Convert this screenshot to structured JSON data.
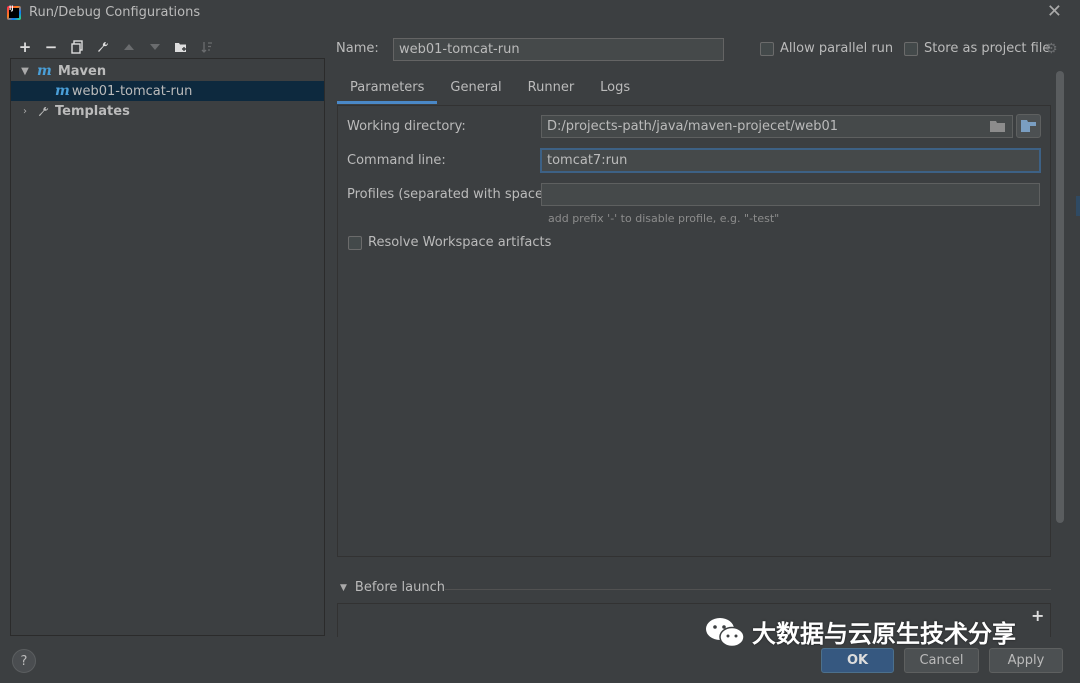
{
  "window": {
    "title": "Run/Debug Configurations",
    "app_icon_text": "IJ"
  },
  "toolbar": {
    "add": "+",
    "remove": "−"
  },
  "tree": {
    "items": [
      {
        "label": "Maven",
        "icon": "maven-m-icon",
        "expanded": true
      },
      {
        "label": "web01-tomcat-run",
        "icon": "maven-m-icon",
        "selected": true
      },
      {
        "label": "Templates",
        "icon": "wrench-icon",
        "expanded": false
      }
    ],
    "maven_glyph": "m"
  },
  "config": {
    "name_label": "Name:",
    "name_value": "web01-tomcat-run",
    "allow_parallel_label": "Allow parallel run",
    "allow_parallel_checked": false,
    "store_as_project_file_label": "Store as project file",
    "store_as_project_file_checked": false
  },
  "tabs": [
    {
      "label": "Parameters",
      "active": true
    },
    {
      "label": "General",
      "active": false
    },
    {
      "label": "Runner",
      "active": false
    },
    {
      "label": "Logs",
      "active": false
    }
  ],
  "parameters": {
    "working_directory_label": "Working directory:",
    "working_directory_value": "D:/projects-path/java/maven-projecet/web01",
    "command_line_label": "Command line:",
    "command_line_value": "tomcat7:run",
    "profiles_label": "Profiles (separated with space):",
    "profiles_value": "",
    "profiles_hint": "add prefix '-' to disable profile, e.g. \"-test\"",
    "resolve_workspace_label": "Resolve Workspace artifacts",
    "resolve_workspace_checked": false
  },
  "before_launch": {
    "label": "Before launch",
    "add": "+"
  },
  "watermark": {
    "text": "大数据与云原生技术分享"
  },
  "buttons": {
    "help": "?",
    "ok": "OK",
    "cancel": "Cancel",
    "apply": "Apply"
  },
  "colors": {
    "background": "#3c3f41",
    "selection": "#0d293e",
    "accent": "#4a88c7",
    "ok_button": "#365880",
    "maven_icon": "#4a9fd8"
  }
}
